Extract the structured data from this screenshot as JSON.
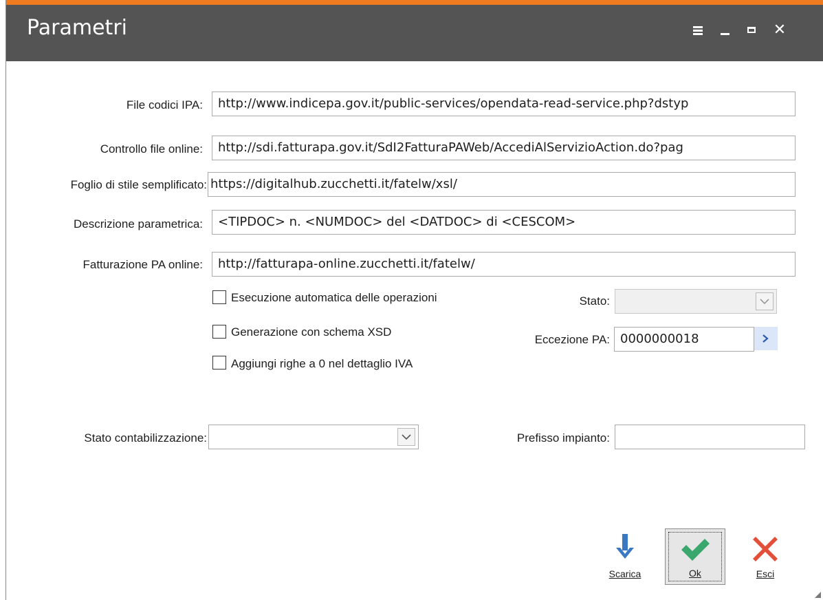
{
  "window": {
    "title": "Parametri"
  },
  "fields": {
    "file_codici_ipa": {
      "label": "File codici IPA:",
      "value": "http://www.indicepa.gov.it/public-services/opendata-read-service.php?dstyp"
    },
    "controllo_file_online": {
      "label": "Controllo file online:",
      "value": "http://sdi.fatturapa.gov.it/SdI2FatturaPAWeb/AccediAlServizioAction.do?pag"
    },
    "foglio_stile": {
      "label": "Foglio di stile semplificato:",
      "value": "https://digitalhub.zucchetti.it/fatelw/xsl/"
    },
    "descrizione_parametrica": {
      "label": "Descrizione parametrica:",
      "value": "<TIPDOC> n. <NUMDOC> del <DATDOC> di <CESCOM>"
    },
    "fatturazione_pa_online": {
      "label": "Fatturazione PA online:",
      "value": "http://fatturapa-online.zucchetti.it/fatelw/"
    }
  },
  "checkboxes": [
    {
      "label": "Esecuzione automatica delle operazioni",
      "checked": false
    },
    {
      "label": "Generazione con schema XSD",
      "checked": false
    },
    {
      "label": "Aggiungi righe a 0 nel dettaglio IVA",
      "checked": false
    }
  ],
  "stato": {
    "label": "Stato:",
    "value": ""
  },
  "eccezione_pa": {
    "label": "Eccezione PA:",
    "value": "0000000018"
  },
  "stato_contabilizzazione": {
    "label": "Stato contabilizzazione:",
    "value": ""
  },
  "prefisso_impianto": {
    "label": "Prefisso impianto:",
    "value": ""
  },
  "actions": {
    "scarica": {
      "label": "Scarica",
      "icon": "download-arrow-icon",
      "color": "#3a78c4"
    },
    "ok": {
      "label": "Ok",
      "icon": "checkmark-icon",
      "color": "#3aa76d"
    },
    "esci": {
      "label": "Esci",
      "icon": "close-x-icon",
      "color": "#e2503a"
    }
  },
  "colors": {
    "titlebar": "#545454",
    "accent": "#f07a1e"
  }
}
